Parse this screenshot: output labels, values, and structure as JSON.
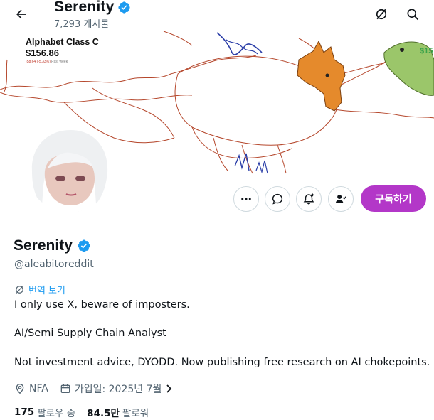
{
  "header": {
    "title": "Serenity",
    "post_count": "7,293 게시물",
    "back_icon": "back-arrow-icon",
    "translate_icon": "translate-icon",
    "search_icon": "search-icon"
  },
  "banner": {
    "stock_name": "Alphabet Class C",
    "stock_price": "$156.86",
    "stock_change": "-$8.64 (-5.33%)",
    "stock_period": "Past week",
    "corner_text": "$15"
  },
  "actions": {
    "more_icon": "more-dots-icon",
    "dm_icon": "message-icon",
    "notify_icon": "bell-plus-icon",
    "following_icon": "person-check-icon",
    "subscribe_label": "구독하기",
    "subscribe_color": "#b337c8"
  },
  "profile": {
    "name": "Serenity",
    "handle": "@aleabitoreddit",
    "translate_label": "번역 보기",
    "bio": [
      "I only use X, beware of imposters.",
      "AI/Semi Supply Chain Analyst",
      "Not investment advice, DYODD. Now publishing free research on AI chokepoints."
    ],
    "location": "NFA",
    "joined": "가입일: 2025년 7월",
    "following_count": "175",
    "following_label": "팔로우 중",
    "followers_count": "84.5만",
    "followers_label": "팔로워",
    "verified_color": "#1d9bf0"
  }
}
